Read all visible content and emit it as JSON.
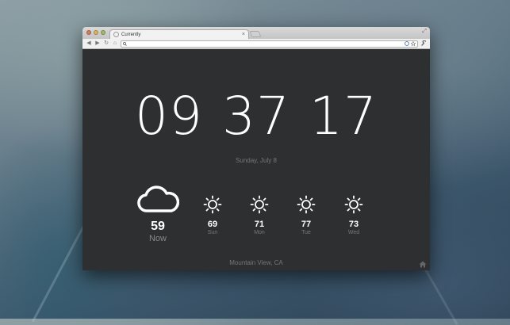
{
  "browser": {
    "tab_title": "Currently",
    "tab_close": "×",
    "resize": "⤢",
    "address": ""
  },
  "clock": {
    "hours": "09",
    "minutes": "37",
    "seconds": "17"
  },
  "date": "Sunday, July 8",
  "current": {
    "temp": "59",
    "label": "Now",
    "icon": "cloud-icon"
  },
  "forecast": [
    {
      "temp": "69",
      "day": "Sun",
      "icon": "sun-icon"
    },
    {
      "temp": "71",
      "day": "Mon",
      "icon": "sun-icon"
    },
    {
      "temp": "77",
      "day": "Tue",
      "icon": "sun-icon"
    },
    {
      "temp": "73",
      "day": "Wed",
      "icon": "sun-icon"
    }
  ],
  "location": "Mountain View, CA",
  "colors": {
    "panel": "#2e2f31",
    "text": "#ffffff",
    "muted": "#777777"
  }
}
